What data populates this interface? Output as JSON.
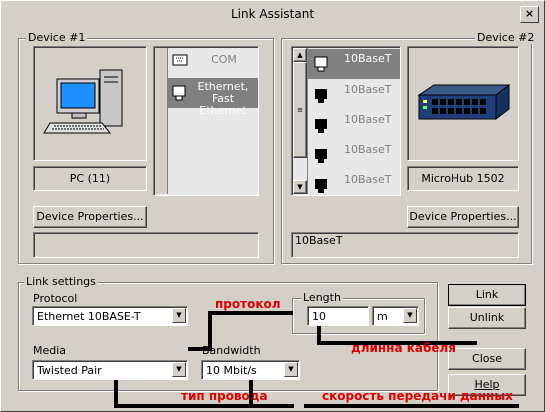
{
  "window": {
    "title": "Link Assistant",
    "close_glyph": "×"
  },
  "device1": {
    "group_label": "Device #1",
    "name": "PC (11)",
    "properties_button": "Device Properties...",
    "ports": [
      {
        "label": "COM",
        "icon": "serial-port-icon",
        "selected": false
      },
      {
        "label": "Ethernet, Fast Ethernet",
        "icon": "ethernet-port-icon",
        "selected": true
      }
    ],
    "info": ""
  },
  "device2": {
    "group_label": "Device #2",
    "name": "MicroHub 1502",
    "properties_button": "Device Properties...",
    "ports": [
      {
        "label": "10BaseT",
        "selected": true
      },
      {
        "label": "10BaseT",
        "selected": false
      },
      {
        "label": "10BaseT",
        "selected": false
      },
      {
        "label": "10BaseT",
        "selected": false
      },
      {
        "label": "10BaseT",
        "selected": false
      }
    ],
    "info": "10BaseT"
  },
  "link_settings": {
    "group_label": "Link settings",
    "protocol_label": "Protocol",
    "protocol_value": "Ethernet 10BASE-T",
    "media_label": "Media",
    "media_value": "Twisted Pair",
    "length_group_label": "Length",
    "length_value": "10",
    "length_unit": "m",
    "bandwidth_label": "Bandwidth",
    "bandwidth_value": "10 Mbit/s"
  },
  "buttons": {
    "link": "Link",
    "unlink": "Unlink",
    "close": "Close",
    "help": "Help"
  },
  "annotations": {
    "protocol": "протокол",
    "length": "длинна кабеля",
    "media": "тип провода",
    "bandwidth": "скорость передачи данных"
  },
  "colors": {
    "annotation": "#e00000",
    "face": "#d4d0c8",
    "selection": "#808080"
  }
}
